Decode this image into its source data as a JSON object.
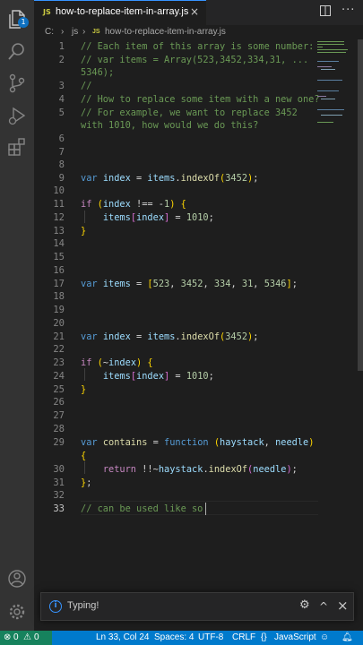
{
  "activity_bar": {
    "items": [
      "files-icon",
      "search-icon",
      "source-control-icon",
      "run-debug-icon",
      "extensions-icon"
    ],
    "bottom": [
      "account-icon",
      "manage-gear-icon"
    ],
    "explorer_badge": "1"
  },
  "tab": {
    "lang_badge": "JS",
    "filename": "how-to-replace-item-in-array.js",
    "close_glyph": "×"
  },
  "breadcrumb": {
    "drive": "C:",
    "folder": "js",
    "lang_badge": "JS",
    "file": "how-to-replace-item-in-array.js"
  },
  "editor": {
    "line_numbers": [
      "1",
      "2",
      "3",
      "4",
      "5",
      "6",
      "7",
      "8",
      "9",
      "10",
      "11",
      "12",
      "13",
      "14",
      "15",
      "16",
      "17",
      "18",
      "19",
      "20",
      "21",
      "22",
      "23",
      "24",
      "25",
      "26",
      "27",
      "28",
      "29",
      "30",
      "31",
      "32",
      "33"
    ],
    "lines": {
      "l1": "// Each item of this array is some number:",
      "l2a": "// var items = Array(523,3452,334,31, ...",
      "l2b": "5346);",
      "l3": "//",
      "l4": "// How to replace some item with a new one?",
      "l5a": "// For example, we want to replace 3452",
      "l5b": "with 1010, how would we do this?",
      "l33": "// can be used like so "
    },
    "active_line": "33"
  },
  "notification": {
    "message": "Typing!",
    "gear": "⚙",
    "collapse": "^",
    "close": "×"
  },
  "status_bar": {
    "errors": "0",
    "warnings": "0",
    "position": "Ln 33, Col 24",
    "spaces": "Spaces: 4",
    "encoding": "UTF-8",
    "eol": "CRLF",
    "braces": "{}",
    "language": "JavaScript"
  },
  "colors": {
    "background": "#1e1e1e",
    "activity_bar": "#333333",
    "status_bar": "#007acc",
    "comment": "#6a9955",
    "keyword": "#569cd6",
    "variable": "#9cdcfe",
    "function": "#dcdcaa",
    "number": "#b5cea8"
  }
}
